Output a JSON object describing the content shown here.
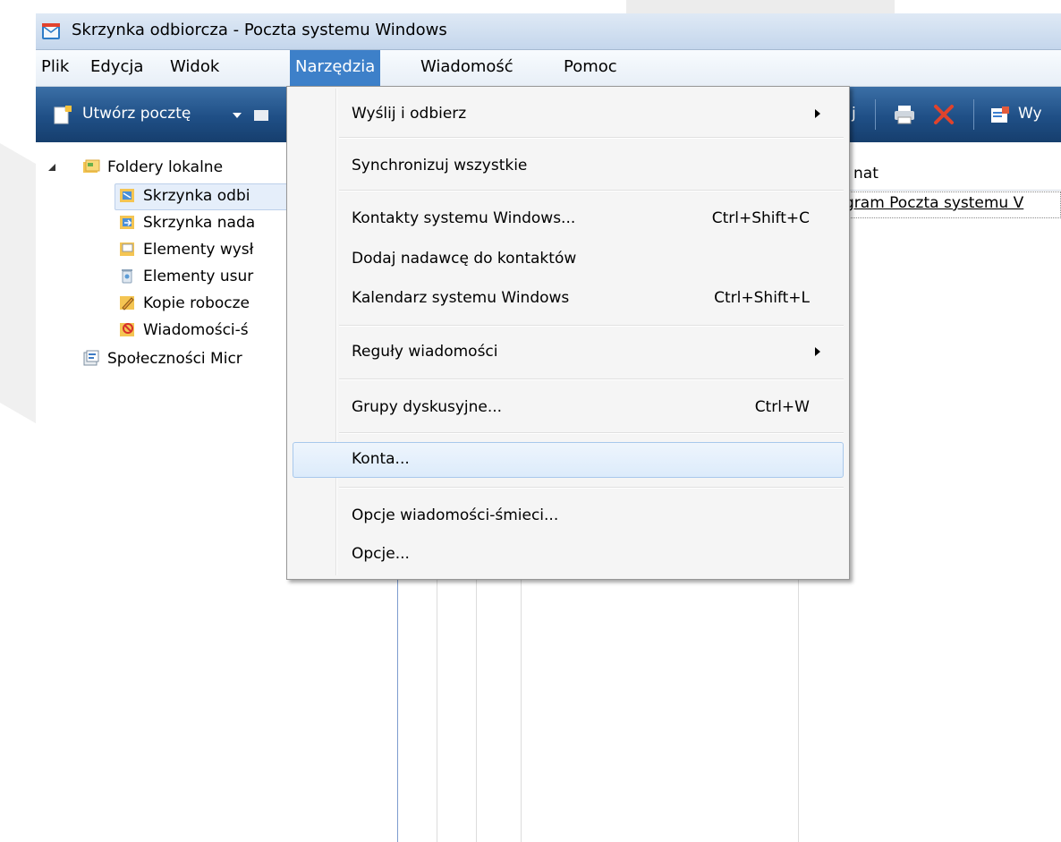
{
  "window": {
    "title": "Skrzynka odbiorcza - Poczta systemu Windows"
  },
  "menubar": {
    "items": [
      {
        "label": "Plik"
      },
      {
        "label": "Edycja"
      },
      {
        "label": "Widok"
      },
      {
        "label": "Narzędzia",
        "active": true
      },
      {
        "label": "Wiadomość"
      },
      {
        "label": "Pomoc"
      }
    ]
  },
  "toolbar": {
    "create_mail_label": "Utwórz pocztę",
    "partial_label_1": "j",
    "partial_label_2": "Wy"
  },
  "folders": {
    "local_folders": "Foldery lokalne",
    "items": [
      {
        "label": "Skrzynka odbi",
        "selected": true
      },
      {
        "label": "Skrzynka nada"
      },
      {
        "label": "Elementy wysł"
      },
      {
        "label": "Elementy usur"
      },
      {
        "label": "Kopie robocze"
      },
      {
        "label": "Wiadomości-ś"
      }
    ],
    "communities": "Społeczności Micr"
  },
  "message_list": {
    "column_subject_partial": "nat",
    "row_subject_partial": "gram Poczta systemu V"
  },
  "tools_menu": {
    "items": [
      {
        "label": "Wyślij i odbierz",
        "submenu": true
      },
      {
        "label": "Synchronizuj wszystkie"
      },
      {
        "label": "Kontakty systemu Windows...",
        "shortcut": "Ctrl+Shift+C"
      },
      {
        "label": "Dodaj nadawcę do kontaktów"
      },
      {
        "label": "Kalendarz systemu Windows",
        "shortcut": "Ctrl+Shift+L"
      },
      {
        "label": "Reguły wiadomości",
        "submenu": true
      },
      {
        "label": "Grupy dyskusyjne...",
        "shortcut": "Ctrl+W"
      },
      {
        "label": "Konta...",
        "highlighted": true
      },
      {
        "label": "Opcje wiadomości-śmieci..."
      },
      {
        "label": "Opcje..."
      }
    ]
  },
  "colors": {
    "menu_active": "#3d80c9",
    "toolbar": "#1f4f86",
    "highlight": "#dcebfb"
  }
}
